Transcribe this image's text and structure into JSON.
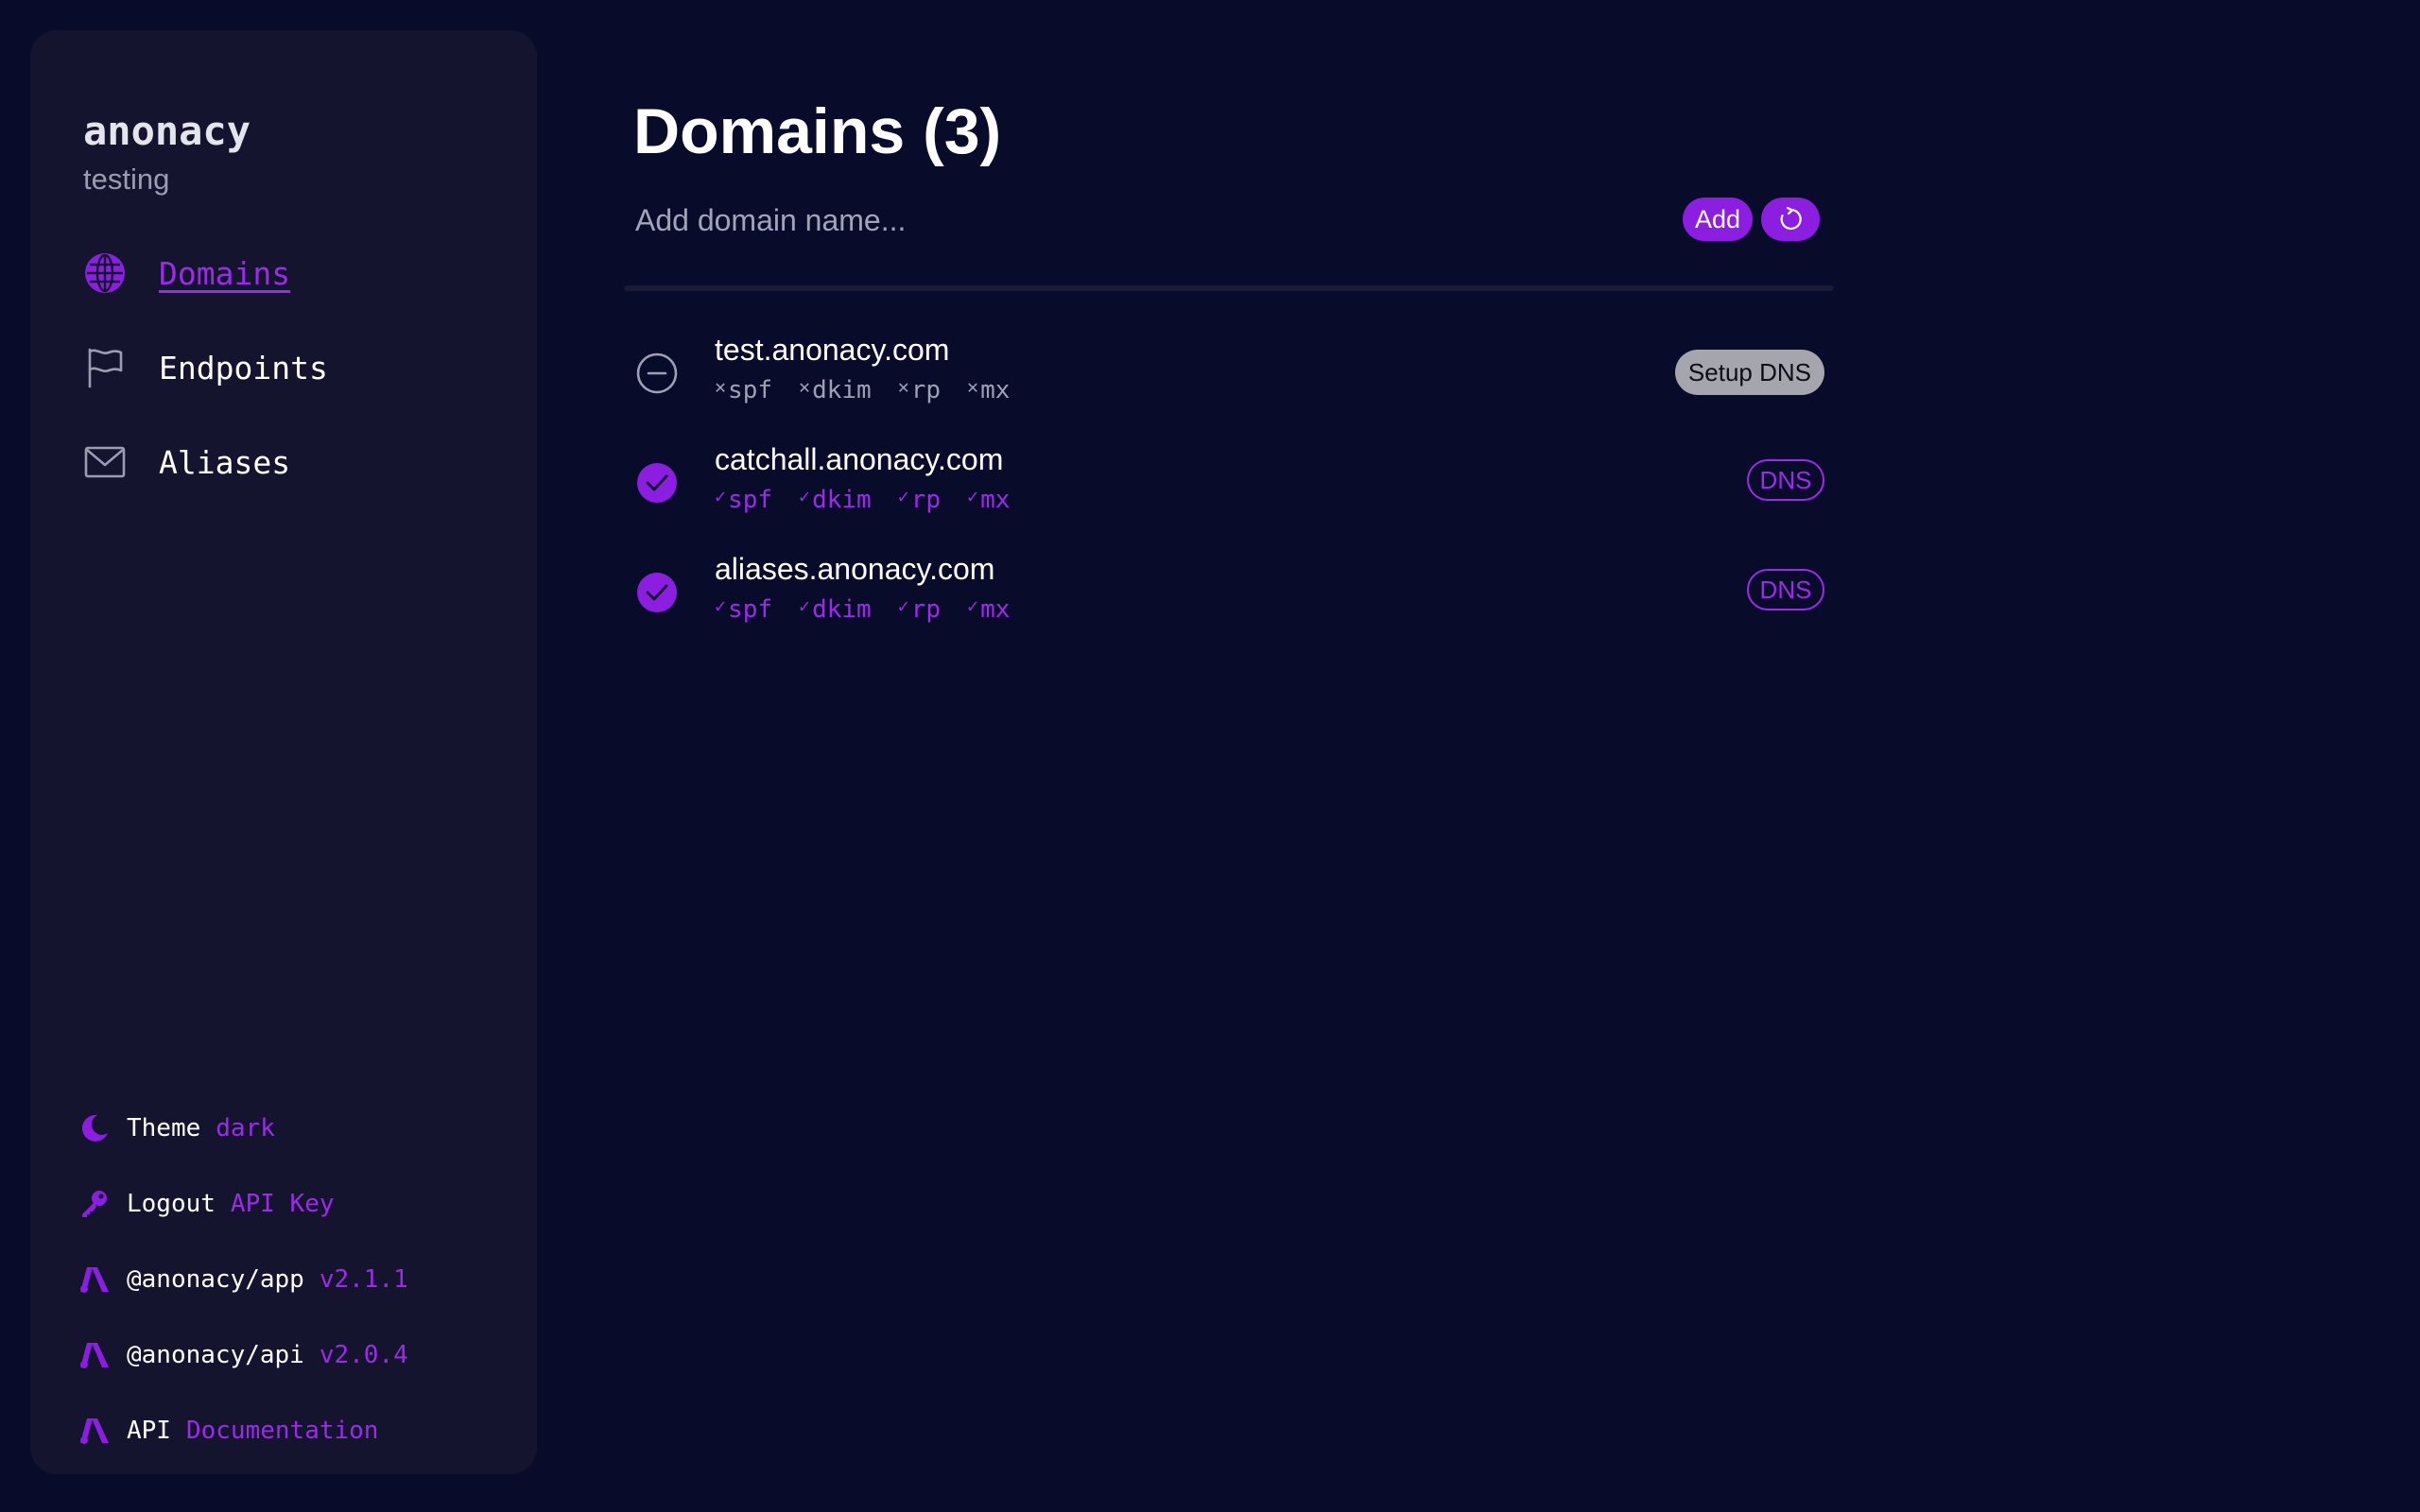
{
  "sidebar": {
    "brand": "anonacy",
    "subtitle": "testing",
    "nav": [
      {
        "label": "Domains",
        "icon": "globe-icon",
        "active": true
      },
      {
        "label": "Endpoints",
        "icon": "flag-icon",
        "active": false
      },
      {
        "label": "Aliases",
        "icon": "envelope-icon",
        "active": false
      }
    ],
    "footer": [
      {
        "key": "Theme",
        "value": "dark",
        "icon": "moon-icon"
      },
      {
        "key": "Logout",
        "value": "API Key",
        "icon": "key-icon"
      },
      {
        "key": "@anonacy/app",
        "value": "v2.1.1",
        "icon": "anonacy-logo-icon"
      },
      {
        "key": "@anonacy/api",
        "value": "v2.0.4",
        "icon": "anonacy-logo-icon"
      },
      {
        "key": "API",
        "value": "Documentation",
        "icon": "anonacy-logo-icon"
      }
    ]
  },
  "main": {
    "title": "Domains (3)",
    "add_placeholder": "Add domain name...",
    "add_label": "Add",
    "refresh_icon": "refresh-icon",
    "domains": [
      {
        "name": "test.anonacy.com",
        "verified": false,
        "records": [
          {
            "label": "spf",
            "mark": "✕"
          },
          {
            "label": "dkim",
            "mark": "✕"
          },
          {
            "label": "rp",
            "mark": "✕"
          },
          {
            "label": "mx",
            "mark": "✕"
          }
        ],
        "action": "Setup DNS"
      },
      {
        "name": "catchall.anonacy.com",
        "verified": true,
        "records": [
          {
            "label": "spf",
            "mark": "✓"
          },
          {
            "label": "dkim",
            "mark": "✓"
          },
          {
            "label": "rp",
            "mark": "✓"
          },
          {
            "label": "mx",
            "mark": "✓"
          }
        ],
        "action": "DNS"
      },
      {
        "name": "aliases.anonacy.com",
        "verified": true,
        "records": [
          {
            "label": "spf",
            "mark": "✓"
          },
          {
            "label": "dkim",
            "mark": "✓"
          },
          {
            "label": "rp",
            "mark": "✓"
          },
          {
            "label": "mx",
            "mark": "✓"
          }
        ],
        "action": "DNS"
      }
    ]
  },
  "colors": {
    "background": "#080b29",
    "sidebar": "#14142e",
    "accent": "#8b1ee0",
    "muted": "#a0a0b4"
  }
}
